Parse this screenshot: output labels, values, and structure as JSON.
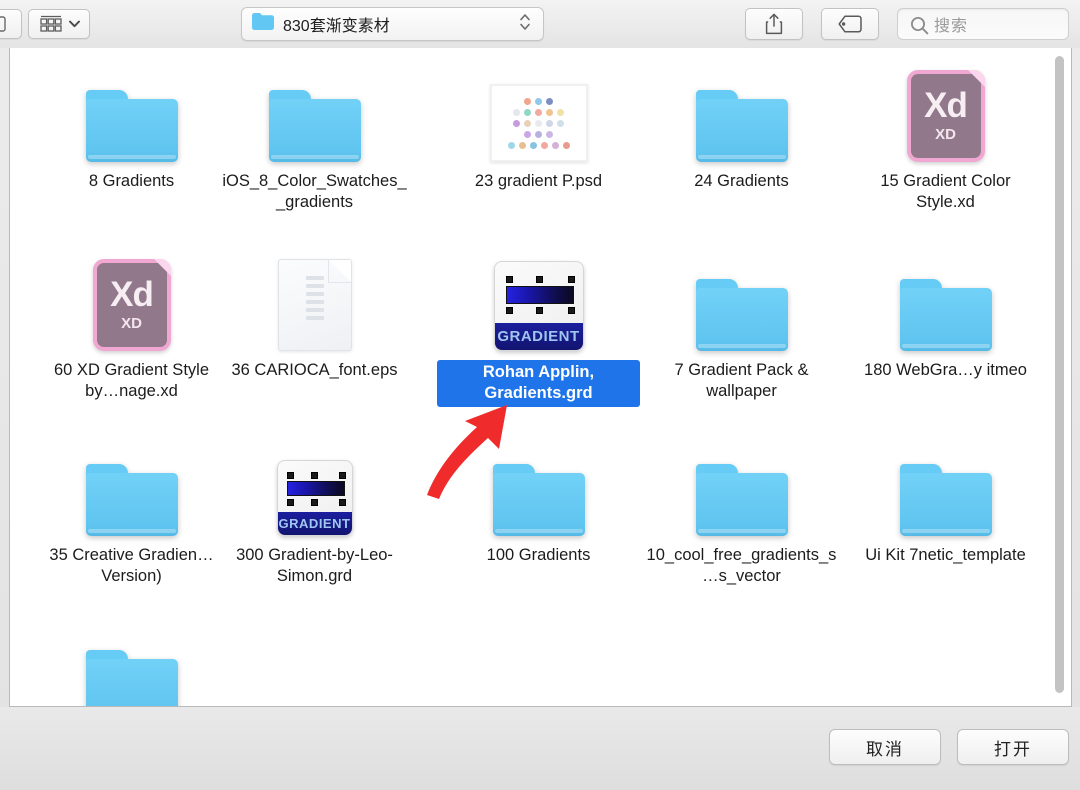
{
  "toolbar": {
    "view_button_icon": "icon-view-grid-icon",
    "view_chevron_icon": "chevron-down-icon",
    "share_icon": "share-icon",
    "tag_icon": "tag-icon",
    "search": {
      "icon": "search-icon",
      "placeholder": "搜索",
      "value": ""
    },
    "path_popup": {
      "folder_icon": "folder-icon",
      "label": "830套渐变素材",
      "stepper_icon": "up-down-stepper-icon"
    }
  },
  "files": [
    {
      "name": "8 Gradients",
      "icon": "folder",
      "selected": false
    },
    {
      "name": "iOS_8_Color_Swatches__gradients",
      "icon": "folder",
      "selected": false
    },
    {
      "name": "23 gradient P.psd",
      "icon": "psd",
      "selected": false
    },
    {
      "name": "24 Gradients",
      "icon": "folder",
      "selected": false
    },
    {
      "name": "15 Gradient Color Style.xd",
      "icon": "xd",
      "selected": false
    },
    {
      "name": "60 XD Gradient Style by…nage.xd",
      "icon": "xd",
      "selected": false
    },
    {
      "name": "36 CARIOCA_font.eps",
      "icon": "document",
      "selected": false
    },
    {
      "name": "Rohan Applin, Gradients.grd",
      "icon": "grd",
      "selected": true
    },
    {
      "name": "7 Gradient Pack & wallpaper",
      "icon": "folder",
      "selected": false
    },
    {
      "name": "180 WebGra…y itmeo",
      "icon": "folder",
      "selected": false
    },
    {
      "name": "35 Creative Gradien…Version)",
      "icon": "folder",
      "selected": false
    },
    {
      "name": "300 Gradient-by-Leo-Simon.grd",
      "icon": "grd",
      "selected": false
    },
    {
      "name": "100 Gradients",
      "icon": "folder",
      "selected": false
    },
    {
      "name": "10_cool_free_gradients_s…s_vector",
      "icon": "folder",
      "selected": false
    },
    {
      "name": "Ui Kit 7netic_template",
      "icon": "folder",
      "selected": false
    },
    {
      "name": "",
      "icon": "folder",
      "selected": false
    }
  ],
  "grd_icon": {
    "badge_text": "GRADIENT"
  },
  "xd_icon": {
    "big_text": "Xd",
    "small_text": "XD"
  },
  "annotation": {
    "arrow_icon": "red-arrow-icon",
    "color": "#ef2b2b"
  },
  "footer": {
    "cancel_label": "取消",
    "open_label": "打开"
  },
  "colors": {
    "selection_blue": "#1e74e8",
    "folder_blue": "#5ec4ef",
    "xd_pink": "#f0a8d2",
    "xd_body": "#91788a",
    "gradient_bar_start": "#2622e0",
    "gradient_bar_end": "#0a0920",
    "annotation_red": "#ef2b2b"
  },
  "psd_thumb_dots": [
    [
      "#f0a58c",
      "#8fc8e8",
      "#7e8ec4"
    ],
    [
      "#e6e6ef",
      "#8fd8c8",
      "#f1a9a0",
      "#f0c390",
      "#efe2a4"
    ],
    [
      "#c89ae0",
      "#e8d2b8",
      "#e9eaf0",
      "#cfd6e8",
      "#cfe0ea"
    ],
    [
      "#c9a7e6",
      "#b9b0e2",
      "#cdb6e6"
    ],
    [
      "#9ed7e8",
      "#e8c08f",
      "#88c4e2",
      "#f0a8a0",
      "#d4b2d8",
      "#e89a8c"
    ]
  ]
}
